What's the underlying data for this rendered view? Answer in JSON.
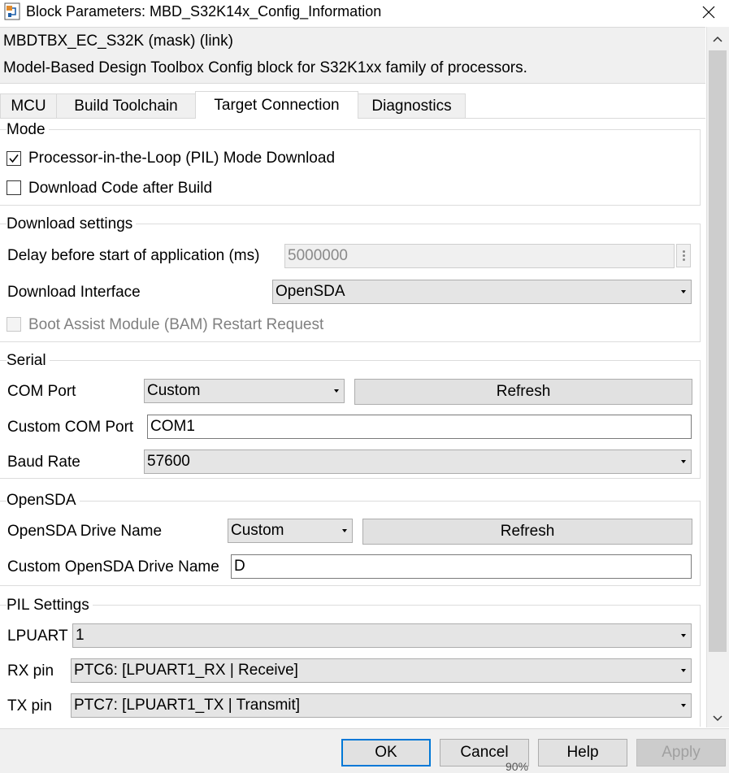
{
  "window": {
    "title": "Block Parameters: MBD_S32K14x_Config_Information",
    "app_icon": "simulink-block-icon",
    "close_icon": "close-icon"
  },
  "header": {
    "mask_title": "MBDTBX_EC_S32K (mask) (link)",
    "description": "Model-Based Design Toolbox Config block for S32K1xx family of processors."
  },
  "tabs": [
    {
      "label": "MCU",
      "active": false
    },
    {
      "label": "Build Toolchain",
      "active": false
    },
    {
      "label": "Target Connection",
      "active": true
    },
    {
      "label": "Diagnostics",
      "active": false
    }
  ],
  "mode": {
    "label": "Mode",
    "pil_label": "Processor-in-the-Loop (PIL) Mode Download",
    "pil_checked": true,
    "download_label": "Download Code after Build",
    "download_checked": false
  },
  "download_settings": {
    "label": "Download settings",
    "delay_label": "Delay before start of application (ms)",
    "delay_value": "5000000",
    "interface_label": "Download Interface",
    "interface_value": "OpenSDA",
    "bam_label": "Boot Assist Module (BAM) Restart Request",
    "bam_checked": false
  },
  "serial": {
    "label": "Serial",
    "com_port_label": "COM Port",
    "com_port_value": "Custom",
    "refresh_label": "Refresh",
    "custom_com_label": "Custom COM Port",
    "custom_com_value": "COM1",
    "baud_label": "Baud Rate",
    "baud_value": "57600"
  },
  "opensda": {
    "label": "OpenSDA",
    "drive_label": "OpenSDA Drive Name",
    "drive_value": "Custom",
    "refresh_label": "Refresh",
    "custom_drive_label": "Custom OpenSDA Drive Name",
    "custom_drive_value": "D"
  },
  "pil": {
    "label": "PIL Settings",
    "lpuart_label": "LPUART",
    "lpuart_value": "1",
    "rx_label": "RX pin",
    "rx_value": "PTC6: [LPUART1_RX | Receive]",
    "tx_label": "TX pin",
    "tx_value": "PTC7: [LPUART1_TX | Transmit]"
  },
  "footer": {
    "ok_label": "OK",
    "cancel_label": "Cancel",
    "help_label": "Help",
    "apply_label": "Apply",
    "zoom_text": "90%"
  },
  "colors": {
    "primary_focus": "#0078d7",
    "panel_gray": "#f0f0f0"
  }
}
